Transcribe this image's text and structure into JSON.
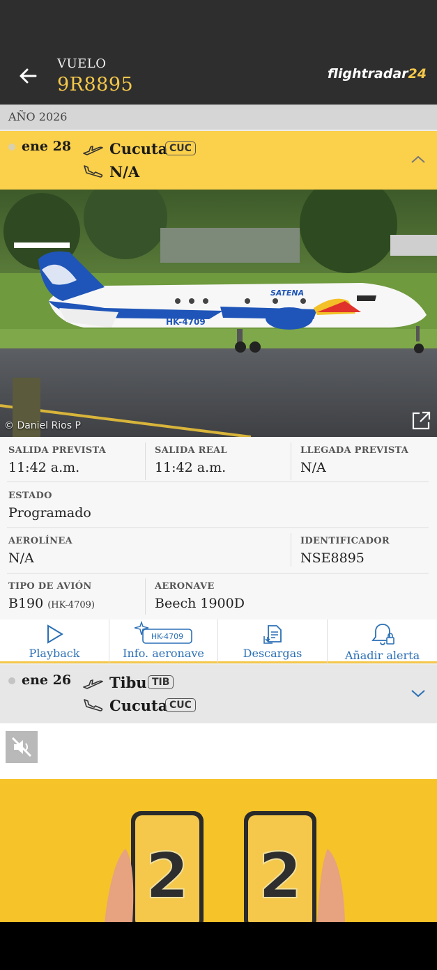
{
  "header": {
    "label": "VUELO",
    "flight_number": "9R8895",
    "brand_text": "flightradar",
    "brand_num": "24"
  },
  "year_label": "AÑO 2026",
  "current_flight": {
    "date": "ene 28",
    "departure_city": "Cucuta",
    "departure_code": "CUC",
    "arrival_city": "N/A"
  },
  "photo": {
    "credit": "© Daniel Rios P",
    "aircraft_livery_text": "SATENA",
    "registration_on_plane": "HK-4709"
  },
  "details": {
    "salida_prevista_label": "SALIDA PREVISTA",
    "salida_prevista_value": "11:42 a.m.",
    "salida_real_label": "SALIDA REAL",
    "salida_real_value": "11:42 a.m.",
    "llegada_prevista_label": "LLEGADA PREVISTA",
    "llegada_prevista_value": "N/A",
    "estado_label": "ESTADO",
    "estado_value": "Programado",
    "aerolinea_label": "AEROLÍNEA",
    "aerolinea_value": "N/A",
    "identificador_label": "IDENTIFICADOR",
    "identificador_value": "NSE8895",
    "tipo_label": "TIPO DE AVIÓN",
    "tipo_value": "B190",
    "tipo_reg": "(HK-4709)",
    "aeronave_label": "AERONAVE",
    "aeronave_value": "Beech 1900D"
  },
  "actions": {
    "playback": "Playback",
    "info_reg": "HK-4709",
    "info": "Info. aeronave",
    "downloads": "Descargas",
    "alert": "Añadir alerta"
  },
  "previous_flight": {
    "date": "ene 26",
    "departure_city": "Tibu",
    "departure_code": "TIB",
    "arrival_city": "Cucuta",
    "arrival_code": "CUC"
  },
  "ad": {
    "digit_left": "2",
    "digit_right": "2"
  },
  "colors": {
    "header_bg": "#2e2e2e",
    "accent_yellow": "#f5c84b",
    "active_row": "#fbd04a",
    "link_blue": "#2b6fb5"
  }
}
